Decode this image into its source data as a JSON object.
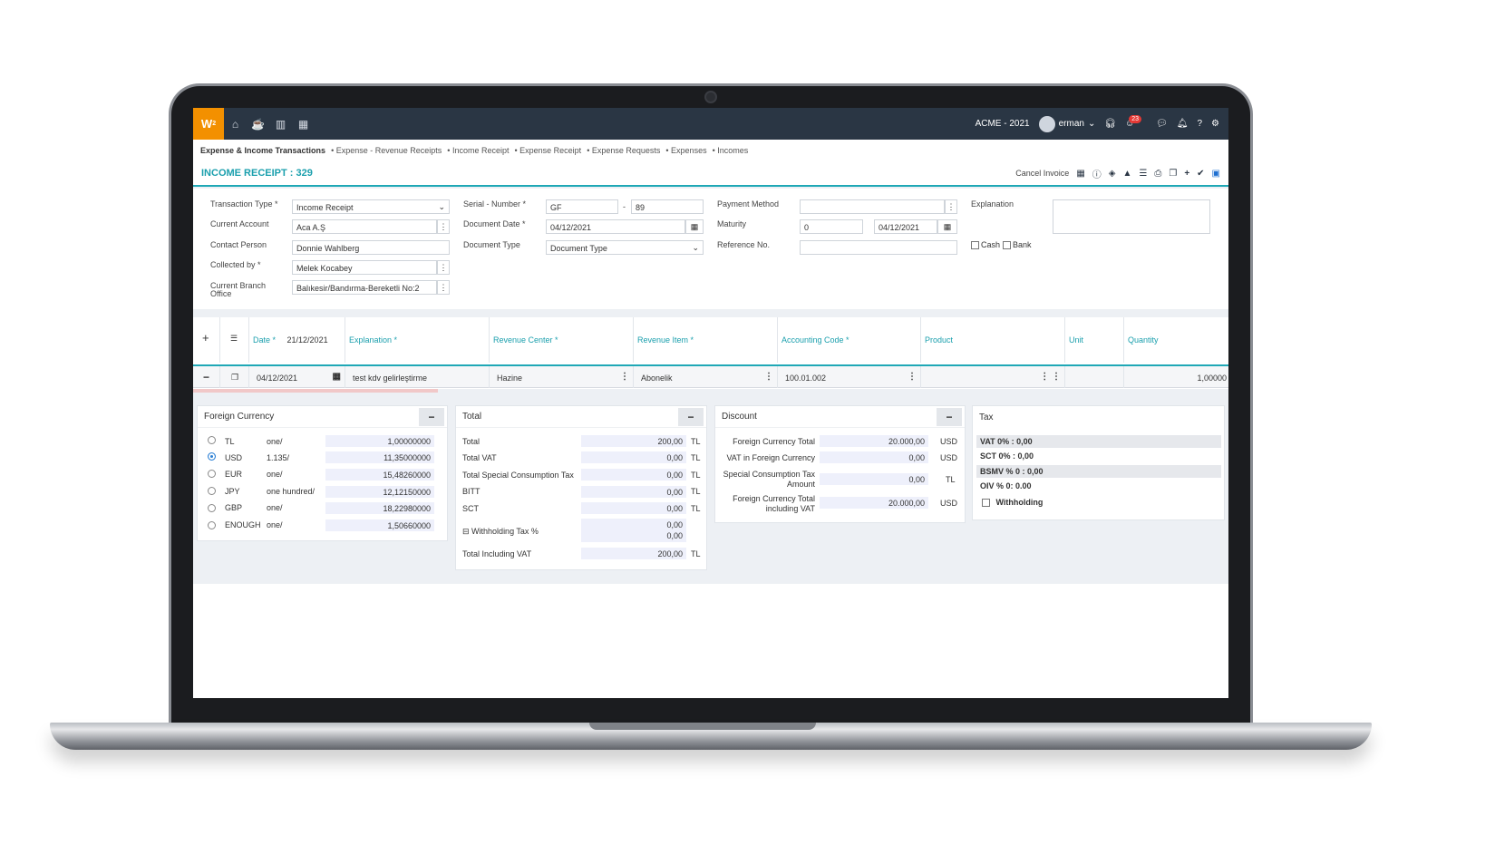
{
  "topbar": {
    "logo": "W",
    "company": "ACME - 2021",
    "user": "erman",
    "notification_count": "23"
  },
  "breadcrumb": {
    "root": "Expense & Income Transactions",
    "items": [
      "Expense - Revenue Receipts",
      "Income Receipt",
      "Expense Receipt",
      "Expense Requests",
      "Expenses",
      "Incomes"
    ]
  },
  "page": {
    "title": "INCOME RECEIPT : 329",
    "cancel_invoice": "Cancel Invoice"
  },
  "form": {
    "transaction_type": {
      "label": "Transaction Type *",
      "value": "Income Receipt"
    },
    "current_account": {
      "label": "Current Account",
      "value": "Aca A.Ş"
    },
    "contact_person": {
      "label": "Contact Person",
      "value": "Donnie Wahlberg"
    },
    "collected_by": {
      "label": "Collected by *",
      "value": "Melek Kocabey"
    },
    "branch_office": {
      "label_1": "Current Branch",
      "label_2": "Office",
      "value": "Balıkesir/Bandırma-Bereketli No:2"
    },
    "serial_number": {
      "label": "Serial - Number *",
      "serial": "GF",
      "dash": "-",
      "number": "89"
    },
    "document_date": {
      "label": "Document Date *",
      "value": "04/12/2021"
    },
    "document_type": {
      "label": "Document Type",
      "value": "Document Type"
    },
    "payment_method": {
      "label": "Payment Method",
      "value": ""
    },
    "maturity": {
      "label": "Maturity",
      "days": "0",
      "date": "04/12/2021"
    },
    "reference_no": {
      "label": "Reference No.",
      "value": ""
    },
    "explanation": {
      "label": "Explanation",
      "value": ""
    },
    "cash_label": "Cash",
    "bank_label": "Bank"
  },
  "grid": {
    "headers": {
      "date": "Date *",
      "header_date_value": "21/12/2021",
      "explanation": "Explanation *",
      "revenue_center": "Revenue Center *",
      "revenue_item": "Revenue Item *",
      "accounting_code": "Accounting Code *",
      "product": "Product",
      "unit": "Unit",
      "quantity": "Quantity"
    },
    "row": {
      "date": "04/12/2021",
      "explanation": "test kdv gelirleştirme",
      "revenue_center": "Hazine",
      "revenue_item": "Abonelik",
      "accounting_code": "100.01.002",
      "product": "",
      "unit": "",
      "quantity": "1,00000"
    }
  },
  "foreign_currency": {
    "title": "Foreign Currency",
    "rows": [
      {
        "code": "TL",
        "unit": "one/",
        "rate": "1,00000000",
        "selected": false
      },
      {
        "code": "USD",
        "unit": "1.135/",
        "rate": "11,35000000",
        "selected": true
      },
      {
        "code": "EUR",
        "unit": "one/",
        "rate": "15,48260000",
        "selected": false
      },
      {
        "code": "JPY",
        "unit": "one hundred/",
        "rate": "12,12150000",
        "selected": false
      },
      {
        "code": "GBP",
        "unit": "one/",
        "rate": "18,22980000",
        "selected": false
      },
      {
        "code": "ENOUGH",
        "unit": "one/",
        "rate": "1,50660000",
        "selected": false
      }
    ]
  },
  "total": {
    "title": "Total",
    "rows": [
      {
        "label": "Total",
        "value": "200,00",
        "cur": "TL"
      },
      {
        "label": "Total VAT",
        "value": "0,00",
        "cur": "TL"
      },
      {
        "label": "Total Special Consumption Tax",
        "value": "0,00",
        "cur": "TL"
      },
      {
        "label": "BITT",
        "value": "0,00",
        "cur": "TL"
      },
      {
        "label": "SCT",
        "value": "0,00",
        "cur": "TL"
      }
    ],
    "withholding_label": "Withholding Tax %",
    "withholding_value_1": "0,00",
    "withholding_value_2": "0,00",
    "incl_vat_label": "Total Including VAT",
    "incl_vat_value": "200,00",
    "incl_vat_cur": "TL"
  },
  "discount": {
    "title": "Discount",
    "fc_total_label": "Foreign Currency Total",
    "fc_total_value": "20.000,00",
    "fc_total_cur": "USD",
    "vat_fc_label": "VAT in Foreign Currency",
    "vat_fc_value": "0,00",
    "vat_fc_cur": "USD",
    "sct_label_1": "Special Consumption Tax",
    "sct_label_2": "Amount",
    "sct_value": "0,00",
    "sct_cur": "TL",
    "fc_incl_label_1": "Foreign Currency Total",
    "fc_incl_label_2": "including VAT",
    "fc_incl_value": "20.000,00",
    "fc_incl_cur": "USD"
  },
  "tax": {
    "title": "Tax",
    "rows": [
      "VAT 0% : 0,00",
      "SCT 0% : 0,00",
      "BSMV % 0 : 0,00",
      "OIV % 0: 0.00"
    ],
    "withholding": "Withholding"
  }
}
